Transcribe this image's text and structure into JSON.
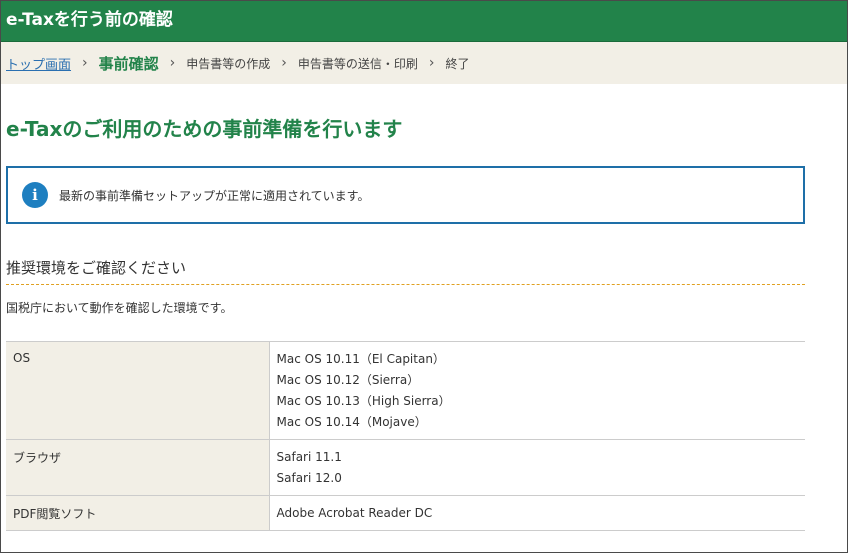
{
  "window": {
    "title": "e-Taxを行う前の確認"
  },
  "breadcrumb": {
    "items": [
      {
        "label": "トップ画面",
        "state": "link"
      },
      {
        "label": "事前確認",
        "state": "current"
      },
      {
        "label": "申告書等の作成",
        "state": "future"
      },
      {
        "label": "申告書等の送信・印刷",
        "state": "future"
      },
      {
        "label": "終了",
        "state": "future"
      }
    ],
    "separator": "›"
  },
  "main": {
    "heading": "e-Taxのご利用のための事前準備を行います",
    "info": {
      "icon": "info-icon",
      "icon_glyph": "i",
      "message": "最新の事前準備セットアップが正常に適用されています。"
    },
    "section": {
      "heading": "推奨環境をご確認ください",
      "description": "国税庁において動作を確認した環境です。"
    },
    "env_table": {
      "rows": [
        {
          "label": "OS",
          "values": [
            "Mac OS 10.11（El Capitan）",
            "Mac OS 10.12（Sierra）",
            "Mac OS 10.13（High Sierra）",
            "Mac OS 10.14（Mojave）"
          ]
        },
        {
          "label": "ブラウザ",
          "values": [
            "Safari 11.1",
            "Safari 12.0"
          ]
        },
        {
          "label": "PDF閲覧ソフト",
          "values": [
            "Adobe Acrobat Reader DC"
          ]
        }
      ]
    }
  },
  "colors": {
    "brand_green": "#22834a",
    "breadcrumb_bg": "#f2efe6",
    "info_border": "#1e6fa8",
    "link_blue": "#2a6fb0",
    "rule_orange": "#e0a020"
  }
}
